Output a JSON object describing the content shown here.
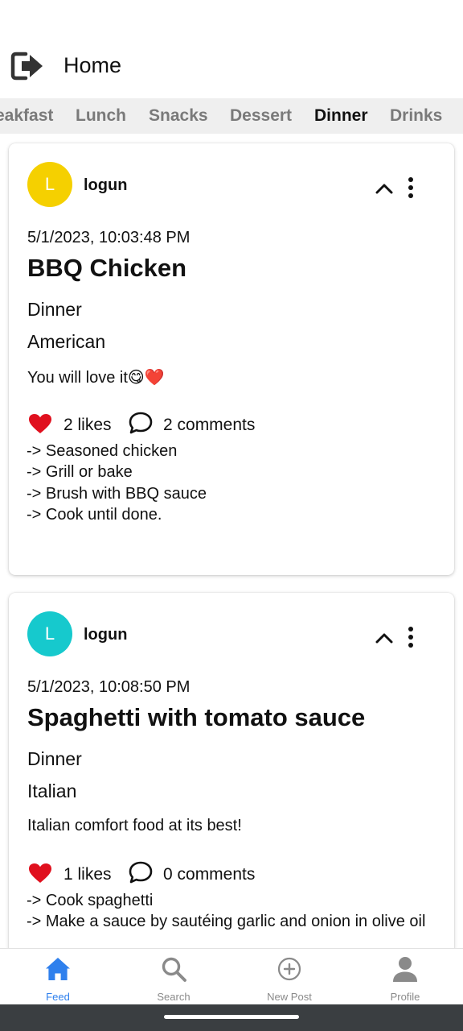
{
  "header": {
    "title": "Home",
    "logout_icon": "logout-icon"
  },
  "tabs": [
    {
      "label": "eakfast",
      "active": false
    },
    {
      "label": "Lunch",
      "active": false
    },
    {
      "label": "Snacks",
      "active": false
    },
    {
      "label": "Dessert",
      "active": false
    },
    {
      "label": "Dinner",
      "active": true
    },
    {
      "label": "Drinks",
      "active": false
    }
  ],
  "posts": [
    {
      "avatar_letter": "L",
      "avatar_color": "#f5d000",
      "username": "logun",
      "timestamp": "5/1/2023, 10:03:48 PM",
      "title": "BBQ Chicken",
      "category": "Dinner",
      "cuisine": "American",
      "description": "You will love it😋❤️",
      "likes": "2 likes",
      "comments": "2 comments",
      "steps": [
        "-> Seasoned chicken",
        "-> Grill or bake",
        "-> Brush with BBQ sauce",
        "-> Cook until done."
      ]
    },
    {
      "avatar_letter": "L",
      "avatar_color": "#16c9cd",
      "username": "logun",
      "timestamp": "5/1/2023, 10:08:50 PM",
      "title": "Spaghetti with tomato sauce",
      "category": "Dinner",
      "cuisine": "Italian",
      "description": "Italian comfort food at its best!",
      "likes": "1 likes",
      "comments": "0 comments",
      "steps": [
        "-> Cook spaghetti",
        "-> Make a sauce by sautéing garlic and onion in olive oil"
      ]
    }
  ],
  "bottom_nav": [
    {
      "label": "Feed",
      "icon": "home-icon",
      "active": true
    },
    {
      "label": "Search",
      "icon": "search-icon",
      "active": false
    },
    {
      "label": "New Post",
      "icon": "add-circle-icon",
      "active": false
    },
    {
      "label": "Profile",
      "icon": "person-icon",
      "active": false
    }
  ],
  "colors": {
    "accent": "#2f80ed",
    "heart": "#e0101e",
    "tab_bar": "#efefef",
    "inactive": "#8a8a8a"
  }
}
